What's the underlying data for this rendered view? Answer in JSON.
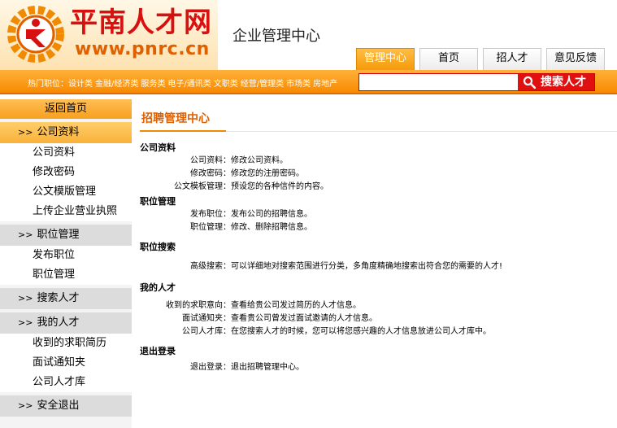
{
  "header": {
    "logo_cn": "平南人才网",
    "logo_url": "www.pnrc.cn",
    "center_title": "企业管理中心"
  },
  "tabs": [
    "管理中心",
    "首页",
    "招人才",
    "意见反馈"
  ],
  "hotbar": {
    "label": "热门职位：",
    "links": [
      "设计类",
      "金融/经济类",
      "服务类",
      "电子/通讯类",
      "文职类",
      "经营/管理类",
      "市场类",
      "房地产"
    ]
  },
  "search": {
    "placeholder": "",
    "button": "搜索人才"
  },
  "sidebar": {
    "home": "返回首页",
    "groups": [
      {
        "title": "公司资料",
        "items": [
          "公司资料",
          "修改密码",
          "公文模版管理",
          "上传企业营业执照"
        ]
      },
      {
        "title": "职位管理",
        "items": [
          "发布职位",
          "职位管理"
        ]
      },
      {
        "title": "搜索人才",
        "items": []
      },
      {
        "title": "我的人才",
        "items": [
          "收到的求职简历",
          "面试通知夹",
          "公司人才库"
        ]
      },
      {
        "title": "安全退出",
        "items": []
      }
    ],
    "prefix": ">>"
  },
  "main": {
    "title": "招聘管理中心",
    "sections": [
      {
        "title": "公司资料",
        "rows": [
          {
            "label": "公司资料：",
            "desc": "修改公司资料。"
          },
          {
            "label": "修改密码：",
            "desc": "修改您的注册密码。"
          },
          {
            "label": "公文模板管理：",
            "desc": "预设您的各种信件的内容。"
          }
        ]
      },
      {
        "title": "职位管理",
        "rows": [
          {
            "label": "发布职位：",
            "desc": "发布公司的招聘信息。"
          },
          {
            "label": "职位管理：",
            "desc": "修改、删除招聘信息。"
          }
        ]
      },
      {
        "title": "职位搜索",
        "rows": [
          {
            "label": "高级搜索：",
            "desc": "可以详细地对搜索范围进行分类，多角度精确地搜索出符合您的需要的人才!"
          }
        ]
      },
      {
        "title": "我的人才",
        "rows": [
          {
            "label": "收到的求职意向：",
            "desc": "查看给贵公司发过简历的人才信息。"
          },
          {
            "label": "面试通知夹：",
            "desc": "查看贵公司曾发过面试邀请的人才信息。"
          },
          {
            "label": "公司人才库：",
            "desc": "在您搜索人才的时候，您可以将您感兴趣的人才信息放进公司人才库中。"
          }
        ]
      },
      {
        "title": "退出登录",
        "rows": [
          {
            "label": "退出登录：",
            "desc": "退出招聘管理中心。"
          }
        ]
      }
    ]
  },
  "colors": {
    "accent": "#f88a00",
    "brand_red": "#d81010",
    "title_orange": "#e06000"
  }
}
